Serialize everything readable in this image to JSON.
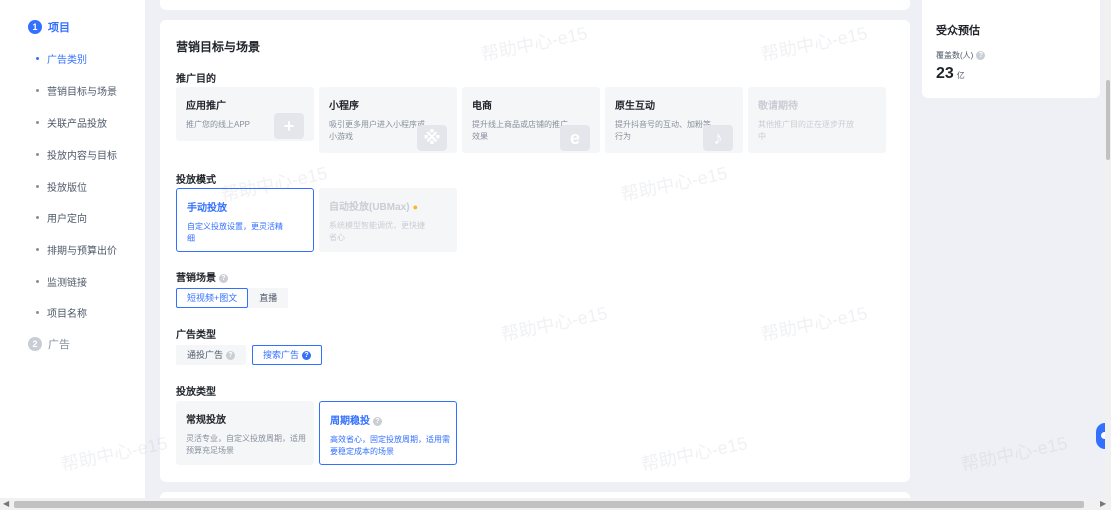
{
  "sidebar": {
    "steps": [
      {
        "num": "1",
        "label": "项目"
      },
      {
        "num": "2",
        "label": "广告"
      }
    ],
    "items": [
      {
        "label": "广告类别"
      },
      {
        "label": "营销目标与场景"
      },
      {
        "label": "关联产品投放"
      },
      {
        "label": "投放内容与目标"
      },
      {
        "label": "投放版位"
      },
      {
        "label": "用户定向"
      },
      {
        "label": "排期与预算出价"
      },
      {
        "label": "监测链接"
      },
      {
        "label": "项目名称"
      }
    ]
  },
  "main": {
    "title": "营销目标与场景",
    "promo_purpose": {
      "title": "推广目的",
      "cards": [
        {
          "title": "应用推广",
          "desc": "推广您的线上APP",
          "icon": "+"
        },
        {
          "title": "小程序",
          "desc": "吸引更多用户进入小程序或小游戏",
          "icon": "※"
        },
        {
          "title": "电商",
          "desc": "提升线上商品或店铺的推广效果",
          "icon": "e"
        },
        {
          "title": "原生互动",
          "desc": "提升抖音号的互动、加粉等行为",
          "icon": "♪"
        },
        {
          "title": "敬请期待",
          "desc": "其他推广目的正在逐步开放中",
          "icon": ""
        }
      ]
    },
    "delivery_mode": {
      "title": "投放模式",
      "cards": [
        {
          "title": "手动投放",
          "desc": "自定义投放设置，更灵活精细"
        },
        {
          "title": "自动投放(UBMax)",
          "desc": "系统模型智能调优，更快捷省心"
        }
      ]
    },
    "marketing_scene": {
      "title": "营销场景",
      "options": [
        "短视频+图文",
        "直播"
      ]
    },
    "ad_type": {
      "title": "广告类型",
      "options": [
        "通投广告",
        "搜索广告"
      ]
    },
    "delivery_type": {
      "title": "投放类型",
      "cards": [
        {
          "title": "常规投放",
          "desc": "灵活专业，自定义投放周期，适用预算充足场景"
        },
        {
          "title": "周期稳投",
          "desc": "高效省心，固定投放周期，适用需要稳定成本的场景"
        }
      ]
    }
  },
  "audience": {
    "title": "受众预估",
    "sub": "覆盖数(人)",
    "value": "23",
    "unit": "亿"
  },
  "watermark": "帮助中心-e15",
  "colors": {
    "accent": "#3370ff",
    "bg": "#eef0f5"
  }
}
